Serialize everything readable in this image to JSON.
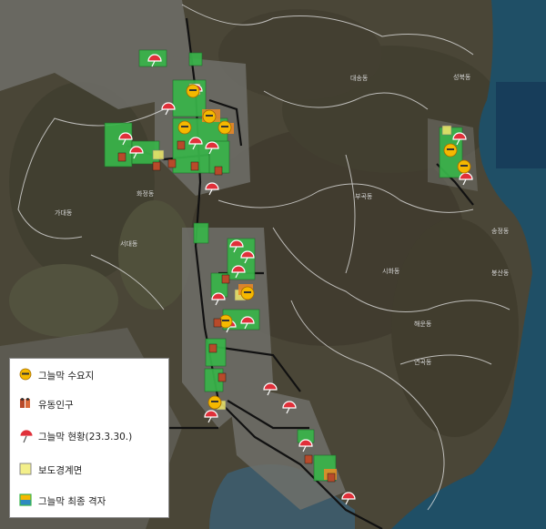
{
  "legend": {
    "items": [
      {
        "label": "그늘막 수요지",
        "icon": "sun-face-icon"
      },
      {
        "label": "유동인구",
        "icon": "people-icon"
      },
      {
        "label": "그늘막 현황(23.3.30.)",
        "icon": "parasol-icon"
      },
      {
        "label": "보도경계면",
        "icon": "yellow-square-icon"
      },
      {
        "label": "그늘막 최종 격자",
        "icon": "grid-cell-icon"
      }
    ]
  },
  "places": [
    "대송동",
    "성북동",
    "가대동",
    "서대동",
    "부곡동",
    "시화동",
    "송정동",
    "봉산동",
    "해운동",
    "연곡동",
    "화정동"
  ],
  "colors": {
    "sea": "#1f4f66",
    "land": "#4a4637",
    "urban": "#6f6f6a",
    "grid_green": "#39b54a",
    "parasol_red": "#e0303a",
    "sun_yellow": "#f5b800"
  }
}
